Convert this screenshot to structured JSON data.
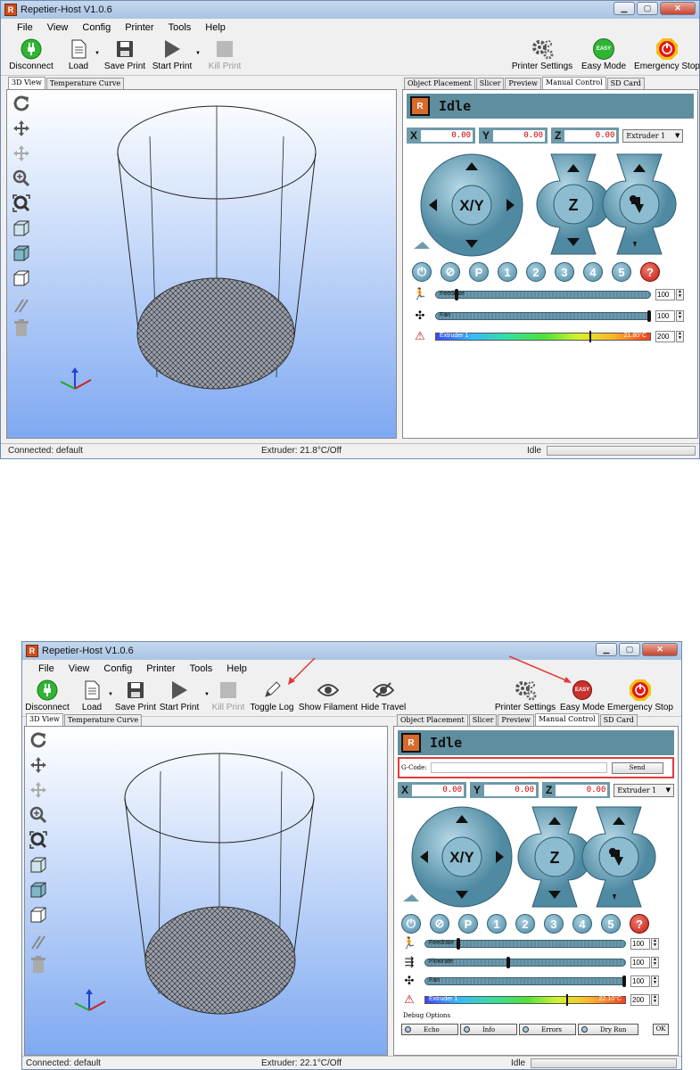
{
  "top": {
    "title": "Repetier-Host V1.0.6",
    "menu": [
      "File",
      "View",
      "Config",
      "Printer",
      "Tools",
      "Help"
    ],
    "toolbar": {
      "disconnect": "Disconnect",
      "load": "Load",
      "save_print": "Save Print",
      "start_print": "Start Print",
      "kill_print": "Kill Print",
      "printer_settings": "Printer Settings",
      "easy_mode": "Easy Mode",
      "emergency_stop": "Emergency Stop",
      "easy_badge": "EASY"
    },
    "left_tabs": [
      "3D View",
      "Temperature Curve"
    ],
    "right_tabs": [
      "Object Placement",
      "Slicer",
      "Preview",
      "Manual Control",
      "SD Card"
    ],
    "status_text": "Idle",
    "coords": {
      "x_label": "X",
      "x": "0.00",
      "y_label": "Y",
      "y": "0.00",
      "z_label": "Z",
      "z": "0.00"
    },
    "extruder_select": "Extruder 1",
    "xy_label": "X/Y",
    "z_label": "Z",
    "macros": [
      "P",
      "1",
      "2",
      "3",
      "4",
      "5",
      "?"
    ],
    "feedrate": {
      "label": "Feedrate",
      "value": "100",
      "fill": 0.1
    },
    "fan": {
      "label": "Fan",
      "value": "100",
      "fill": 1.0
    },
    "extruder": {
      "label": "Extruder 1",
      "temp": "21.80°C",
      "value": "200",
      "marker": 0.73
    },
    "statusbar": {
      "left": "Connected: default",
      "mid": "Extruder: 21.8°C/Off",
      "right": "Idle"
    }
  },
  "bottom": {
    "title": "Repetier-Host V1.0.6",
    "menu": [
      "File",
      "View",
      "Config",
      "Printer",
      "Tools",
      "Help"
    ],
    "toolbar": {
      "disconnect": "Disconnect",
      "load": "Load",
      "save_print": "Save Print",
      "start_print": "Start Print",
      "kill_print": "Kill Print",
      "toggle_log": "Toggle Log",
      "show_filament": "Show Filament",
      "hide_travel": "Hide Travel",
      "printer_settings": "Printer Settings",
      "easy_mode": "Easy Mode",
      "emergency_stop": "Emergency Stop",
      "easy_badge": "EASY"
    },
    "left_tabs": [
      "3D View",
      "Temperature Curve"
    ],
    "right_tabs": [
      "Object Placement",
      "Slicer",
      "Preview",
      "Manual Control",
      "SD Card"
    ],
    "status_text": "Idle",
    "gcode": {
      "label": "G-Code:",
      "send": "Send"
    },
    "coords": {
      "x_label": "X",
      "x": "0.00",
      "y_label": "Y",
      "y": "0.00",
      "z_label": "Z",
      "z": "0.00"
    },
    "extruder_select": "Extruder 1",
    "xy_label": "X/Y",
    "z_label": "Z",
    "macros": [
      "P",
      "1",
      "2",
      "3",
      "4",
      "5",
      "?"
    ],
    "feedrate": {
      "label": "Feedrate",
      "value": "100",
      "fill": 0.17
    },
    "flowrate": {
      "label": "Flowrate",
      "value": "100",
      "fill": 0.42
    },
    "fan": {
      "label": "Fan",
      "value": "100",
      "fill": 1.0
    },
    "extruder": {
      "label": "Extruder 1",
      "temp": "22.10°C",
      "value": "200",
      "marker": 0.72
    },
    "debug": {
      "title": "Debug Options",
      "buttons": [
        "Echo",
        "Info",
        "Errors",
        "Dry Run"
      ],
      "ok": "OK"
    },
    "statusbar": {
      "left": "Connected: default",
      "mid": "Extruder: 22.1°C/Off",
      "right": "Idle"
    }
  },
  "colors": {
    "accent": "#5f8f9f",
    "highlight": "#e23a3a",
    "easy_green": "#2fb534",
    "easy_red": "#c8322a"
  }
}
